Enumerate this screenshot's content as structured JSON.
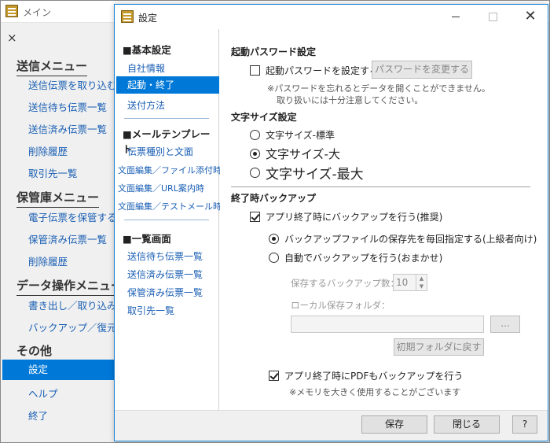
{
  "main": {
    "title": "メイン",
    "close_glyph": "×",
    "sections": [
      {
        "label": "送信メニュー",
        "items": [
          "送信伝票を取り込む",
          "送信待ち伝票一覧",
          "送信済み伝票一覧",
          "削除履歴",
          "取引先一覧"
        ]
      },
      {
        "label": "保管庫メニュー",
        "items": [
          "電子伝票を保管する",
          "保管済み伝票一覧",
          "削除履歴"
        ]
      },
      {
        "label": "データ操作メニュー",
        "items": [
          "書き出し／取り込み",
          "バックアップ／復元"
        ]
      },
      {
        "label": "その他",
        "items": [
          "設定",
          "ヘルプ",
          "終了"
        ]
      }
    ],
    "selected_item": "設定"
  },
  "dialog": {
    "title": "設定",
    "window_buttons": {
      "close": "✕"
    },
    "nav": {
      "section1": "■基本設定",
      "section1_items": [
        "自社情報",
        "起動・終了",
        "送付方法"
      ],
      "section2": "■メールテンプレート",
      "section2_items": [
        "伝票種別と文面",
        "文面編集／ファイル添付時",
        "文面編集／URL案内時",
        "文面編集／テストメール時"
      ],
      "section3": "■一覧画面",
      "section3_items": [
        "送信待ち伝票一覧",
        "送信済み伝票一覧",
        "保管済み伝票一覧",
        "取引先一覧"
      ]
    },
    "password": {
      "heading": "起動パスワード設定",
      "checkbox_label": "起動パスワードを設定する",
      "checked": false,
      "change_button": "パスワードを変更する",
      "note1": "※パスワードを忘れるとデータを開くことができません。",
      "note2": "取り扱いには十分注意してください。"
    },
    "font_size": {
      "heading": "文字サイズ設定",
      "options": [
        "文字サイズ-標準",
        "文字サイズ-大",
        "文字サイズ-最大"
      ],
      "selected": "文字サイズ-大"
    },
    "backup": {
      "heading": "終了時バックアップ",
      "checkbox_label": "アプリ終了時にバックアップを行う(推奨)",
      "checked": true,
      "option_manual": "バックアップファイルの保存先を毎回指定する(上級者向け)",
      "option_auto": "自動でバックアップを行う(おまかせ)",
      "selected": "バックアップファイルの保存先を毎回指定する(上級者向け)",
      "count_label": "保存するバックアップ数：",
      "count_value": "10",
      "folder_label": "ローカル保存フォルダ：",
      "folder_value": "",
      "browse_button": "...",
      "reset_button": "初期フォルダに戻す",
      "pdf_checkbox_label": "アプリ終了時にPDFもバックアップを行う",
      "pdf_checked": true,
      "pdf_note": "※メモリを大きく使用することがございます"
    },
    "footer": {
      "save": "保存",
      "close": "閉じる",
      "help": "?"
    }
  }
}
